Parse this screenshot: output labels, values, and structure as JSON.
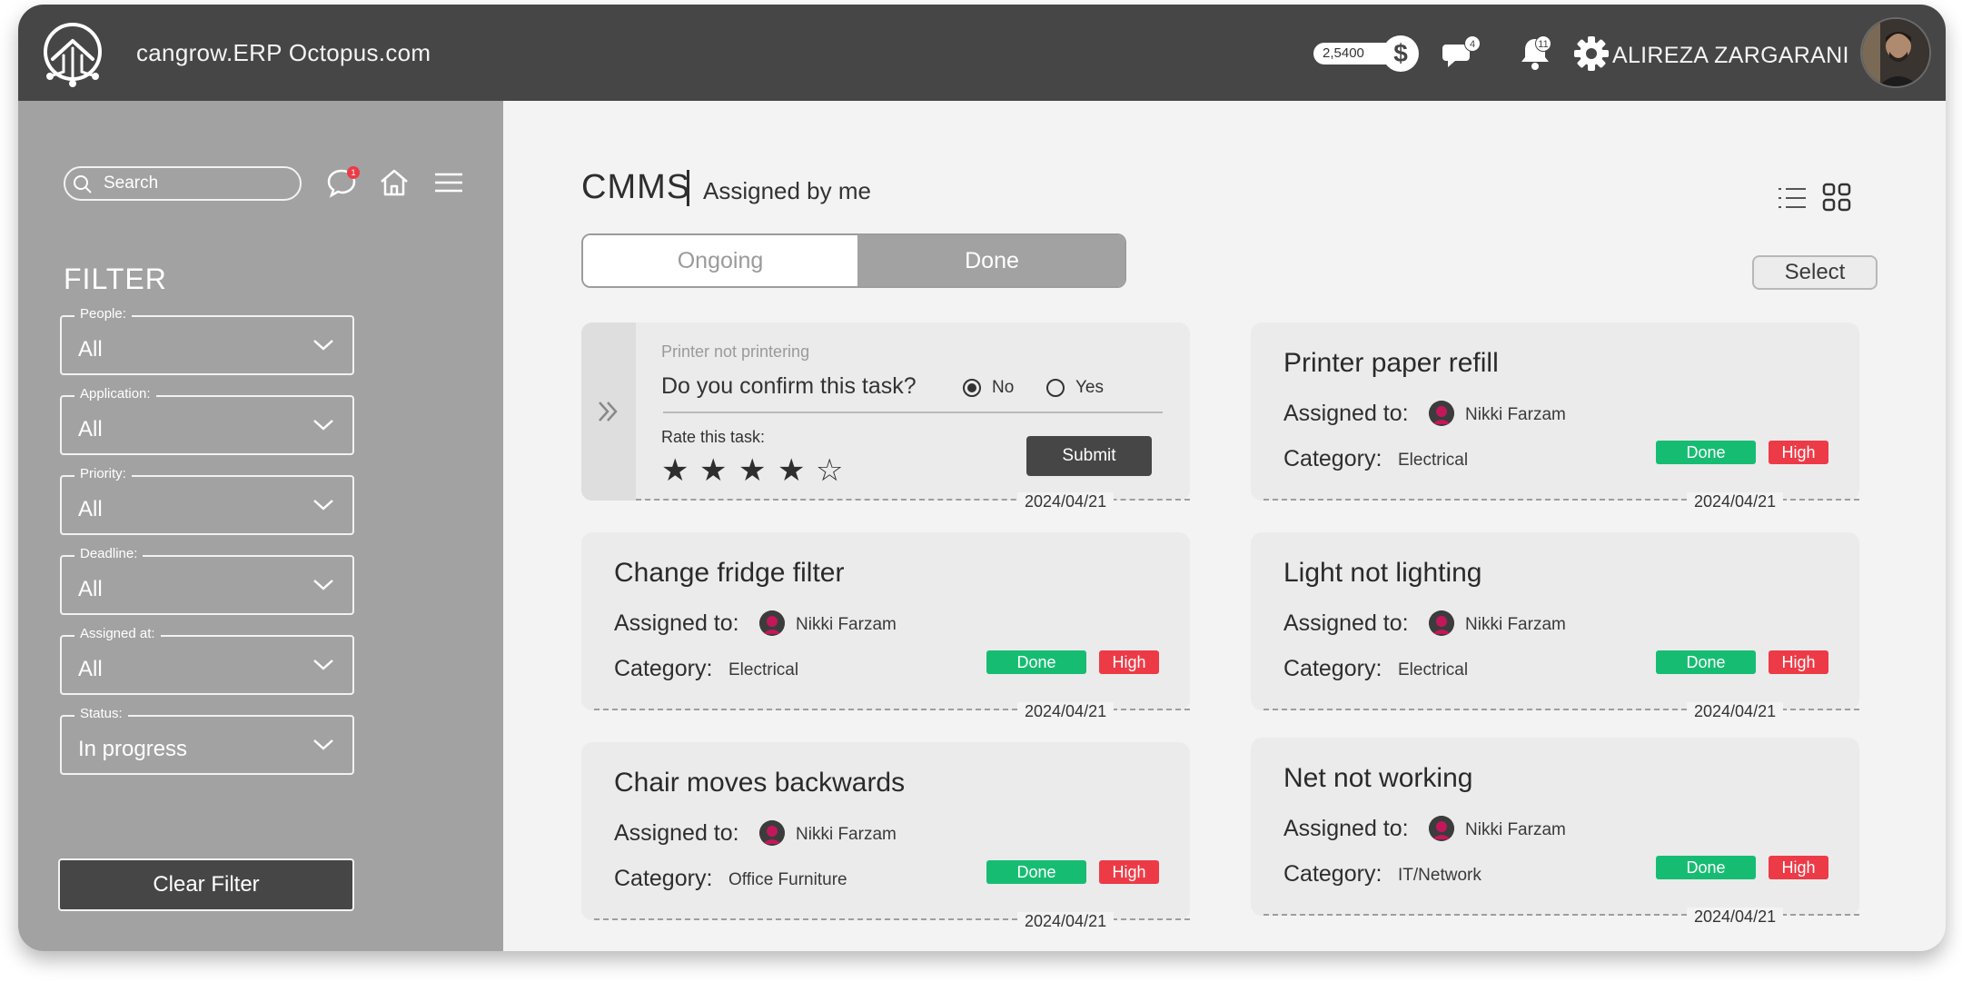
{
  "header": {
    "app_title": "cangrow.ERP Octopus.com",
    "balance": "2,5400",
    "currency_symbol": "$",
    "messages_count": "4",
    "notifications_count": "11",
    "user_name": "ALIREZA ZARGARANI"
  },
  "sidebar": {
    "search_placeholder": "Search",
    "chat_badge": "1",
    "filter_title": "FILTER",
    "filters": [
      {
        "label": "People:",
        "value": "All"
      },
      {
        "label": "Application:",
        "value": "All"
      },
      {
        "label": "Priority:",
        "value": "All"
      },
      {
        "label": "Deadline:",
        "value": "All"
      },
      {
        "label": "Assigned at:",
        "value": "All"
      },
      {
        "label": "Status:",
        "value": "In progress"
      }
    ],
    "clear_filter": "Clear Filter"
  },
  "main": {
    "title": "CMMS",
    "subtitle": "Assigned by me",
    "tabs": [
      {
        "label": "Ongoing",
        "active": false
      },
      {
        "label": "Done",
        "active": true
      }
    ],
    "select_label": "Select",
    "assigned_label": "Assigned to:",
    "category_label": "Category:",
    "confirm_card": {
      "task_name": "Printer not printering",
      "question": "Do you confirm this task?",
      "option_no": "No",
      "option_yes": "Yes",
      "selected": "No",
      "rate_label": "Rate this task:",
      "rating": 4,
      "rating_max": 5,
      "submit": "Submit",
      "date": "2024/04/21"
    },
    "cards": [
      {
        "title": "Printer paper refill",
        "assignee": "Nikki Farzam",
        "category": "Electrical",
        "status": "Done",
        "priority": "High",
        "date": "2024/04/21"
      },
      {
        "title": "Change fridge filter",
        "assignee": "Nikki Farzam",
        "category": "Electrical",
        "status": "Done",
        "priority": "High",
        "date": "2024/04/21"
      },
      {
        "title": "Light not lighting",
        "assignee": "Nikki Farzam",
        "category": "Electrical",
        "status": "Done",
        "priority": "High",
        "date": "2024/04/21"
      },
      {
        "title": "Chair moves backwards",
        "assignee": "Nikki Farzam",
        "category": "Office Furniture",
        "status": "Done",
        "priority": "High",
        "date": "2024/04/21"
      },
      {
        "title": "Net not working",
        "assignee": "Nikki Farzam",
        "category": "IT/Network",
        "status": "Done",
        "priority": "High",
        "date": "2024/04/21"
      }
    ]
  },
  "colors": {
    "header_bg": "#464646",
    "sidebar_bg": "#a2a2a2",
    "done_green": "#17bc73",
    "high_red": "#ec3b47"
  }
}
